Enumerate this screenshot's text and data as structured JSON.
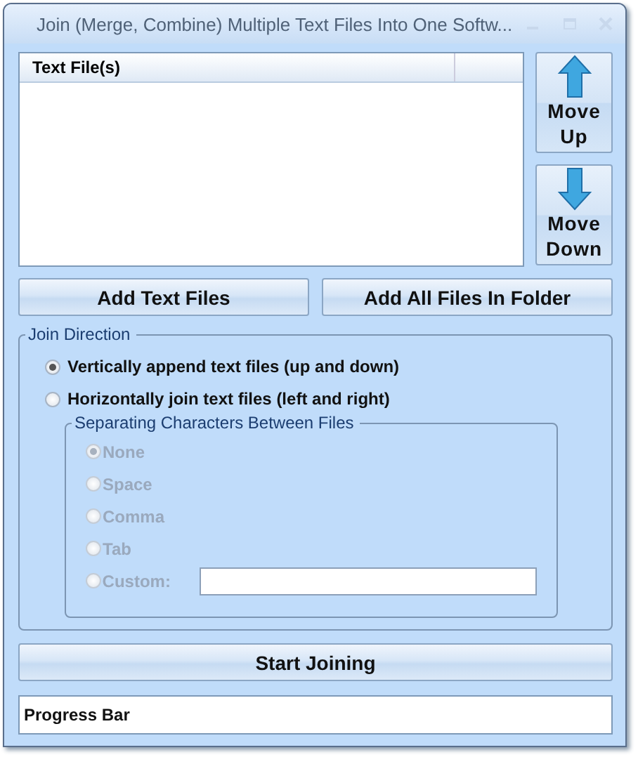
{
  "window": {
    "title": "Join (Merge, Combine) Multiple Text Files Into One Softw..."
  },
  "file_list": {
    "columns": [
      "Text File(s)"
    ]
  },
  "move_buttons": [
    {
      "label": "Move Up",
      "kind": "up"
    },
    {
      "label": "Move Down",
      "kind": "down"
    }
  ],
  "add_buttons": [
    "Add Text Files",
    "Add All Files In Folder"
  ],
  "join_direction": {
    "title": "Join Direction",
    "options": [
      {
        "label": "Vertically append text files (up and down)",
        "selected": true
      },
      {
        "label": "Horizontally join text files (left and right)",
        "selected": false
      }
    ],
    "separator": {
      "title": "Separating Characters Between Files",
      "disabled": true,
      "options": [
        {
          "label": "None",
          "selected": true,
          "kind": "plain"
        },
        {
          "label": "Space",
          "selected": false,
          "kind": "plain"
        },
        {
          "label": "Comma",
          "selected": false,
          "kind": "plain"
        },
        {
          "label": "Tab",
          "selected": false,
          "kind": "plain"
        },
        {
          "label": "Custom:",
          "selected": false,
          "kind": "custom"
        }
      ]
    }
  },
  "start_button": "Start Joining",
  "progress_bar": {
    "text": "Progress Bar"
  }
}
